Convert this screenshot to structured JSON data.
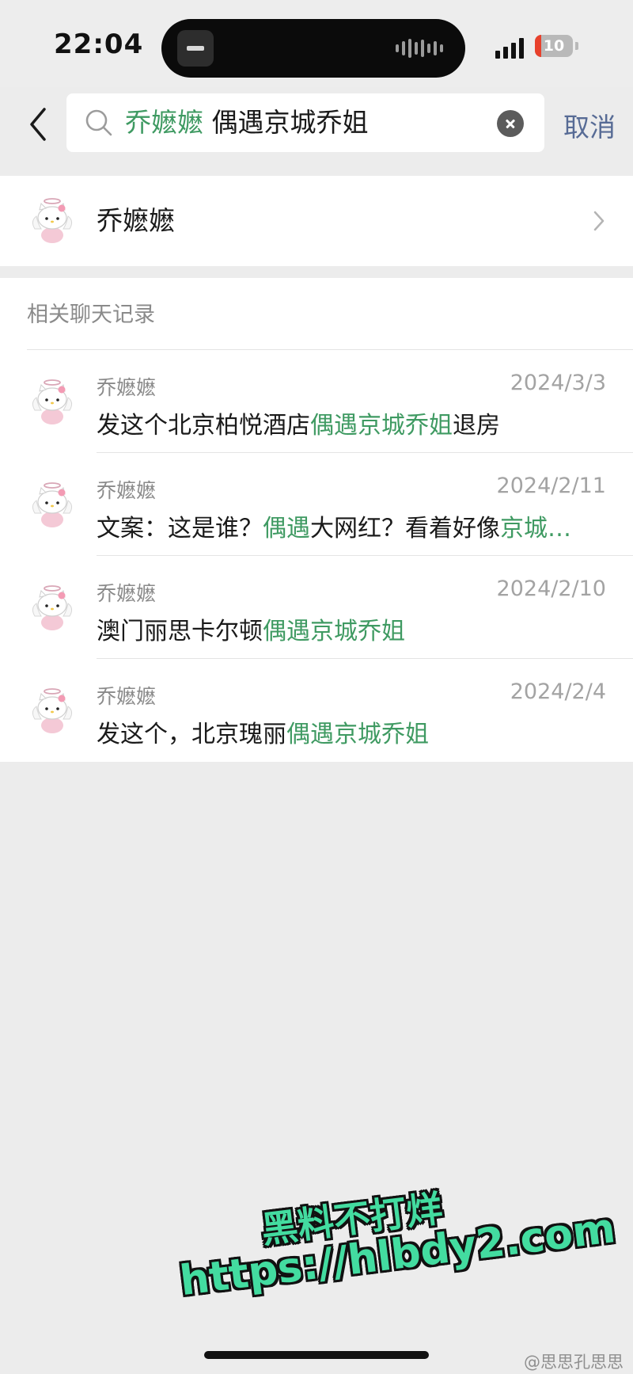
{
  "status_bar": {
    "time": "22:04",
    "battery_level": "10",
    "battery_color": "#e8412c"
  },
  "search": {
    "query_contact": "乔嬷嬷",
    "query_keyword": "偶遇京城乔姐",
    "cancel_label": "取消",
    "highlight_color": "#3f9a62",
    "link_color": "#576b95"
  },
  "contact_result": {
    "name": "乔嬷嬷",
    "avatar_icon": "hello-kitty-angel-avatar"
  },
  "chat_records": {
    "header": "相关聊天记录",
    "items": [
      {
        "sender": "乔嬷嬷",
        "date": "2024/3/3",
        "text_before": "发这个北京柏悦酒店",
        "highlight": "偶遇京城乔姐",
        "text_mid": "退房",
        "highlight2": ""
      },
      {
        "sender": "乔嬷嬷",
        "date": "2024/2/11",
        "text_before": "文案：这是谁？",
        "highlight": "偶遇",
        "text_mid": "大网红？看着好像",
        "highlight2": "京城…"
      },
      {
        "sender": "乔嬷嬷",
        "date": "2024/2/10",
        "text_before": "澳门丽思卡尔顿",
        "highlight": "偶遇京城乔姐",
        "text_mid": "",
        "highlight2": ""
      },
      {
        "sender": "乔嬷嬷",
        "date": "2024/2/4",
        "text_before": "发这个，北京瑰丽",
        "highlight": "偶遇京城乔姐",
        "text_mid": "",
        "highlight2": ""
      }
    ]
  },
  "watermark": {
    "line1": "黑料不打烊",
    "line2": "https://hlbdy2.com"
  },
  "credit": "@思思孔思思"
}
